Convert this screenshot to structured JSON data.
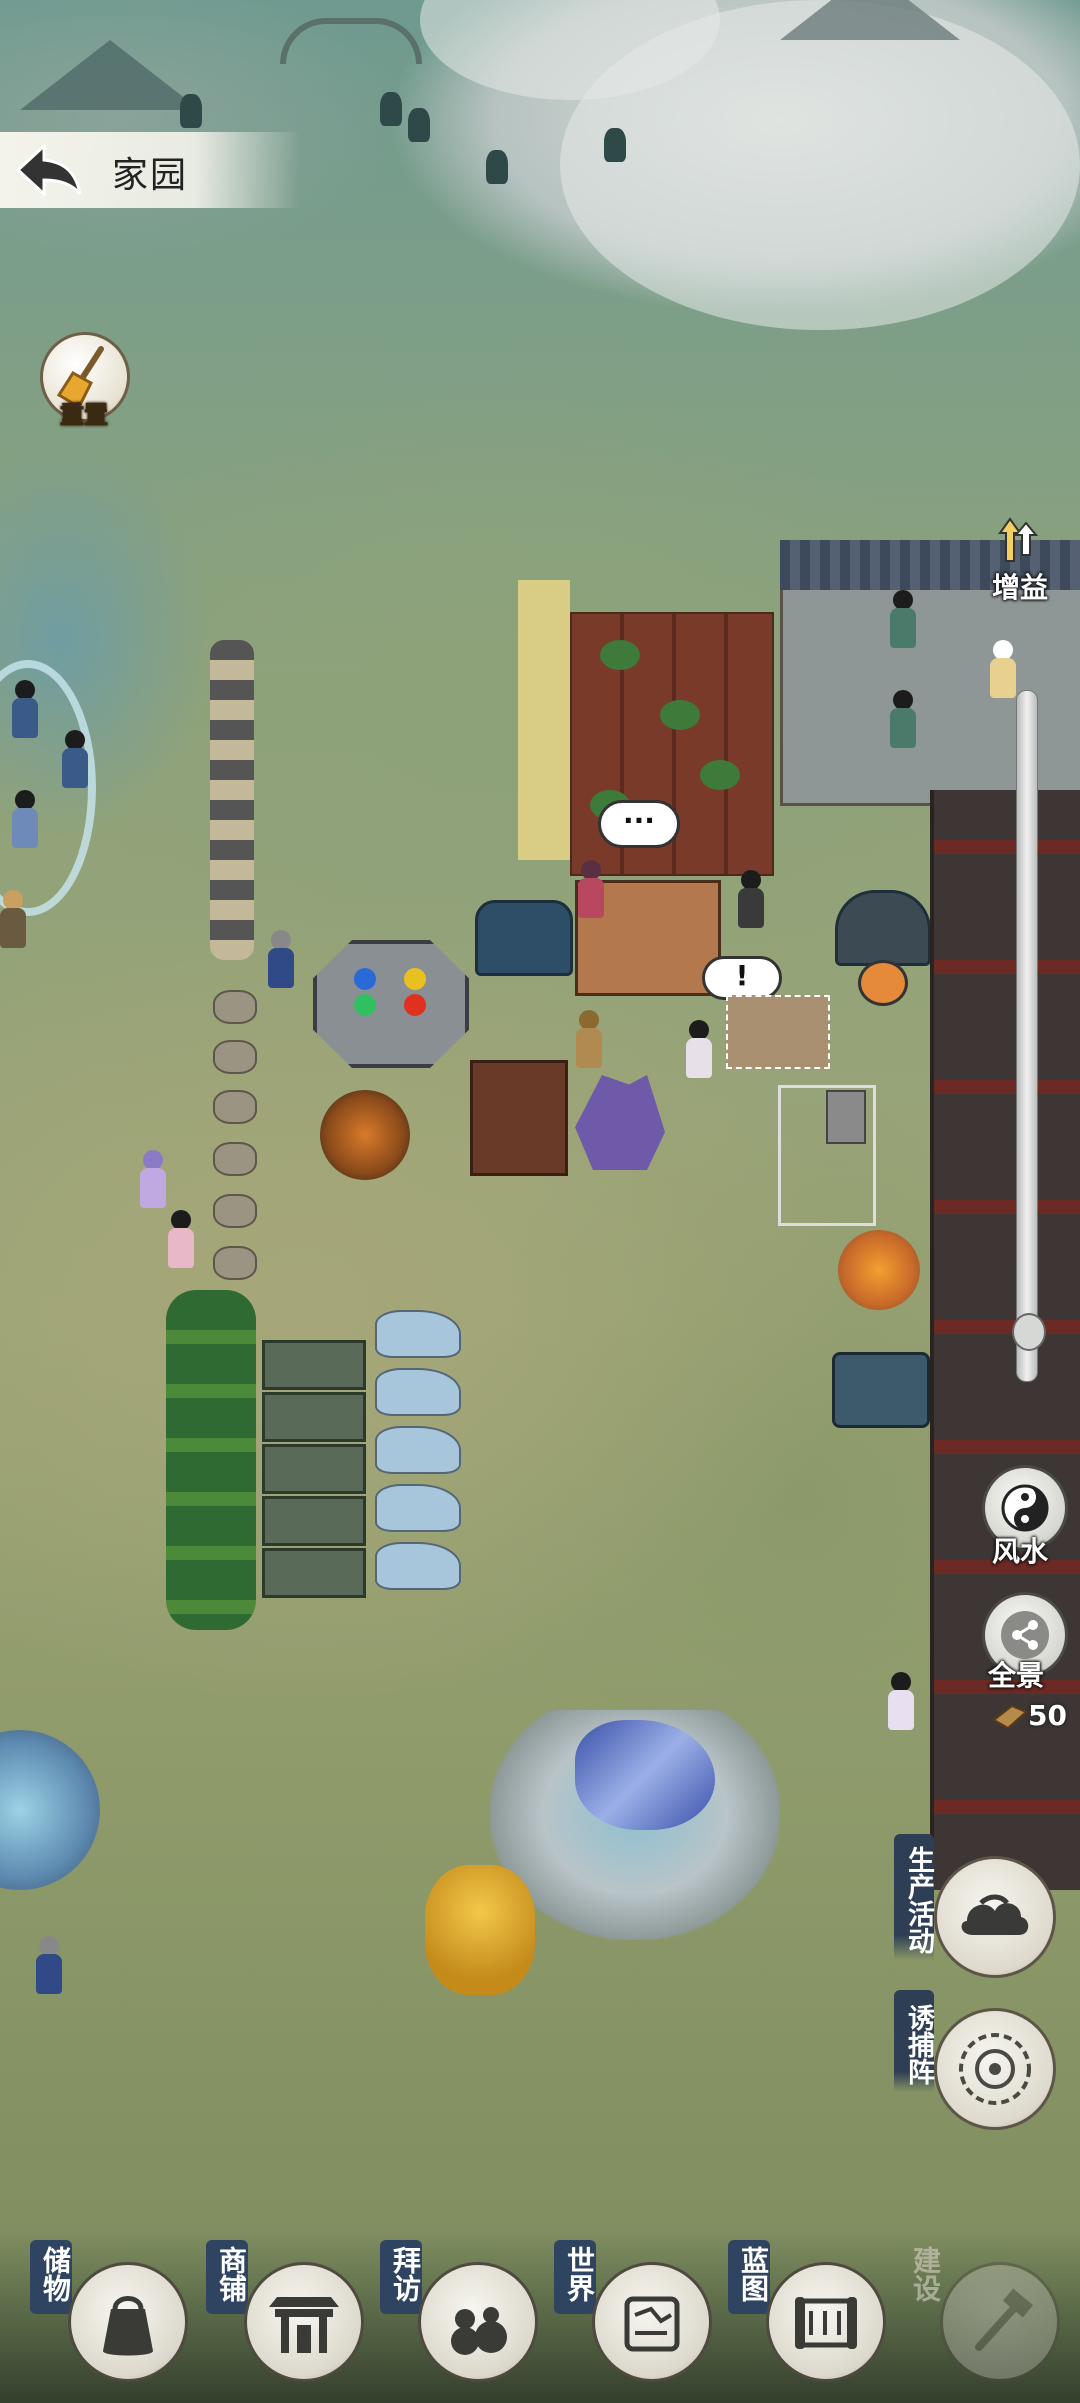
{
  "header": {
    "title": "家园",
    "back_icon": "back-arrow-icon"
  },
  "reset": {
    "label": "重置",
    "icon": "broom-icon"
  },
  "map": {
    "bubbles": [
      {
        "text": "···"
      },
      {
        "text": "!"
      }
    ]
  },
  "right_controls": {
    "boost": {
      "label": "增益",
      "icon": "arrows-up-icon"
    },
    "fengshui": {
      "label": "风水",
      "icon": "yin-yang-icon"
    },
    "panorama": {
      "label": "全景",
      "icon": "share-icon"
    },
    "coin": {
      "value": "50",
      "icon": "material-icon"
    },
    "production": {
      "label": "生产活动",
      "icon": "cloud-icon"
    },
    "trap": {
      "label": "诱捕阵",
      "icon": "formation-icon"
    }
  },
  "zoom": {
    "level": 0.95
  },
  "bottom_nav": {
    "items": [
      {
        "label": "储物",
        "icon": "bag-icon",
        "enabled": true
      },
      {
        "label": "商铺",
        "icon": "shop-gate-icon",
        "enabled": true
      },
      {
        "label": "拜访",
        "icon": "visit-gourd-icon",
        "enabled": true
      },
      {
        "label": "世界",
        "icon": "scroll-map-icon",
        "enabled": true
      },
      {
        "label": "蓝图",
        "icon": "blueprint-icon",
        "enabled": true
      },
      {
        "label": "建设",
        "icon": "hammer-icon",
        "enabled": false
      }
    ]
  },
  "colors": {
    "tag_blue": "#2f4460",
    "accent_gold": "#f2c84a"
  }
}
